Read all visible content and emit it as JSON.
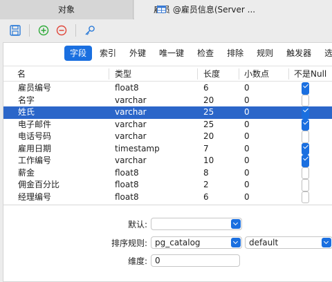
{
  "tabs": {
    "objects_label": "对象",
    "active_label": "雇员 @雇员信息(Server ..."
  },
  "toolbar": {
    "save_icon": "save-icon",
    "add_icon": "add-field-icon",
    "remove_icon": "remove-field-icon",
    "key_icon": "primary-key-icon"
  },
  "subtabs": [
    "字段",
    "索引",
    "外键",
    "唯一键",
    "检查",
    "排除",
    "规则",
    "触发器",
    "选项"
  ],
  "grid": {
    "headers": {
      "name": "名",
      "type": "类型",
      "length": "长度",
      "decimals": "小数点",
      "notnull": "不是Null"
    },
    "rows": [
      {
        "name": "雇员编号",
        "type": "float8",
        "length": "6",
        "decimals": "0",
        "notnull": true
      },
      {
        "name": "名字",
        "type": "varchar",
        "length": "20",
        "decimals": "0",
        "notnull": false
      },
      {
        "name": "姓氏",
        "type": "varchar",
        "length": "25",
        "decimals": "0",
        "notnull": true
      },
      {
        "name": "电子邮件",
        "type": "varchar",
        "length": "25",
        "decimals": "0",
        "notnull": true
      },
      {
        "name": "电话号码",
        "type": "varchar",
        "length": "20",
        "decimals": "0",
        "notnull": false
      },
      {
        "name": "雇用日期",
        "type": "timestamp",
        "length": "7",
        "decimals": "0",
        "notnull": true
      },
      {
        "name": "工作编号",
        "type": "varchar",
        "length": "10",
        "decimals": "0",
        "notnull": true
      },
      {
        "name": "薪金",
        "type": "float8",
        "length": "8",
        "decimals": "0",
        "notnull": false
      },
      {
        "name": "佣金百分比",
        "type": "float8",
        "length": "2",
        "decimals": "0",
        "notnull": false
      },
      {
        "name": "经理编号",
        "type": "float8",
        "length": "6",
        "decimals": "0",
        "notnull": false
      }
    ],
    "selected_index": 2
  },
  "form": {
    "default_label": "默认:",
    "default_value": "",
    "collation_label": "排序规则:",
    "collation_schema": "pg_catalog",
    "collation_value": "default",
    "dimension_label": "维度:",
    "dimension_value": "0"
  },
  "colors": {
    "accent": "#1a6fe0",
    "selection": "#2b66c9"
  }
}
